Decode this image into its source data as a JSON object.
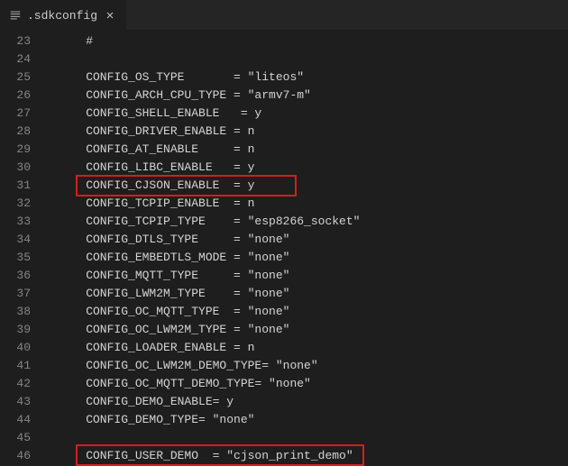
{
  "tab": {
    "title": ".sdkconfig"
  },
  "gutter": {
    "start": 23,
    "end": 46
  },
  "lines": {
    "l23": "    #",
    "l24": "",
    "l25": "    CONFIG_OS_TYPE       = \"liteos\"",
    "l26": "    CONFIG_ARCH_CPU_TYPE = \"armv7-m\"",
    "l27": "    CONFIG_SHELL_ENABLE   = y",
    "l28": "    CONFIG_DRIVER_ENABLE = n",
    "l29": "    CONFIG_AT_ENABLE     = n",
    "l30": "    CONFIG_LIBC_ENABLE   = y",
    "l31": "    CONFIG_CJSON_ENABLE  = y",
    "l32": "    CONFIG_TCPIP_ENABLE  = n",
    "l33": "    CONFIG_TCPIP_TYPE    = \"esp8266_socket\"",
    "l34": "    CONFIG_DTLS_TYPE     = \"none\"",
    "l35": "    CONFIG_EMBEDTLS_MODE = \"none\"",
    "l36": "    CONFIG_MQTT_TYPE     = \"none\"",
    "l37": "    CONFIG_LWM2M_TYPE    = \"none\"",
    "l38": "    CONFIG_OC_MQTT_TYPE  = \"none\"",
    "l39": "    CONFIG_OC_LWM2M_TYPE = \"none\"",
    "l40": "    CONFIG_LOADER_ENABLE = n",
    "l41": "    CONFIG_OC_LWM2M_DEMO_TYPE= \"none\"",
    "l42": "    CONFIG_OC_MQTT_DEMO_TYPE= \"none\"",
    "l43": "    CONFIG_DEMO_ENABLE= y",
    "l44": "    CONFIG_DEMO_TYPE= \"none\"",
    "l45": "",
    "l46": "    CONFIG_USER_DEMO  = \"cjson_print_demo\""
  },
  "chart_data": {
    "file": ".sdkconfig",
    "settings": [
      {
        "key": "CONFIG_OS_TYPE",
        "value": "\"liteos\""
      },
      {
        "key": "CONFIG_ARCH_CPU_TYPE",
        "value": "\"armv7-m\""
      },
      {
        "key": "CONFIG_SHELL_ENABLE",
        "value": "y"
      },
      {
        "key": "CONFIG_DRIVER_ENABLE",
        "value": "n"
      },
      {
        "key": "CONFIG_AT_ENABLE",
        "value": "n"
      },
      {
        "key": "CONFIG_LIBC_ENABLE",
        "value": "y"
      },
      {
        "key": "CONFIG_CJSON_ENABLE",
        "value": "y",
        "highlighted": true
      },
      {
        "key": "CONFIG_TCPIP_ENABLE",
        "value": "n"
      },
      {
        "key": "CONFIG_TCPIP_TYPE",
        "value": "\"esp8266_socket\""
      },
      {
        "key": "CONFIG_DTLS_TYPE",
        "value": "\"none\""
      },
      {
        "key": "CONFIG_EMBEDTLS_MODE",
        "value": "\"none\""
      },
      {
        "key": "CONFIG_MQTT_TYPE",
        "value": "\"none\""
      },
      {
        "key": "CONFIG_LWM2M_TYPE",
        "value": "\"none\""
      },
      {
        "key": "CONFIG_OC_MQTT_TYPE",
        "value": "\"none\""
      },
      {
        "key": "CONFIG_OC_LWM2M_TYPE",
        "value": "\"none\""
      },
      {
        "key": "CONFIG_LOADER_ENABLE",
        "value": "n"
      },
      {
        "key": "CONFIG_OC_LWM2M_DEMO_TYPE",
        "value": "\"none\""
      },
      {
        "key": "CONFIG_OC_MQTT_DEMO_TYPE",
        "value": "\"none\""
      },
      {
        "key": "CONFIG_DEMO_ENABLE",
        "value": "y"
      },
      {
        "key": "CONFIG_DEMO_TYPE",
        "value": "\"none\""
      },
      {
        "key": "CONFIG_USER_DEMO",
        "value": "\"cjson_print_demo\"",
        "highlighted": true
      }
    ]
  }
}
